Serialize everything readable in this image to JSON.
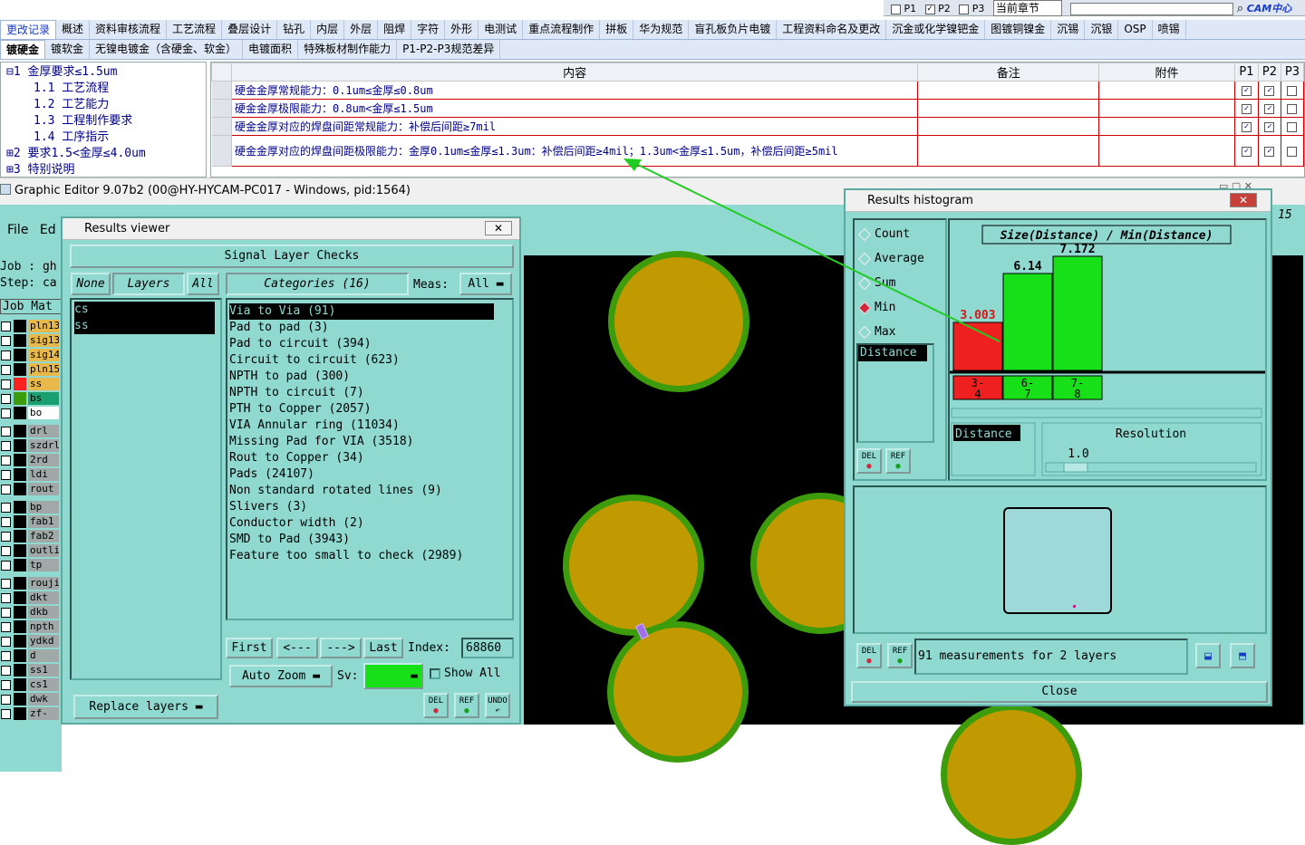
{
  "top_controls": {
    "p1": "P1",
    "p2": "P2",
    "p3": "P3",
    "section_select": "当前章节",
    "logo": "CAM中心"
  },
  "tabs_row1": [
    "更改记录",
    "概述",
    "资料审核流程",
    "工艺流程",
    "叠层设计",
    "钻孔",
    "内层",
    "外层",
    "阻焊",
    "字符",
    "外形",
    "电测试",
    "重点流程制作",
    "拼板",
    "华为规范",
    "盲孔板负片电镀",
    "工程资料命名及更改",
    "沉金或化学镍钯金",
    "图镀铜镍金",
    "沉锡",
    "沉银",
    "OSP",
    "喷锡"
  ],
  "tabs_row2": [
    "镀硬金",
    "镀软金",
    "无镍电镀金（含硬金、软金）",
    "电镀面积",
    "特殊板材制作能力",
    "P1-P2-P3规范差异"
  ],
  "tree": [
    "⊟1 金厚要求≤1.5um",
    "1.1 工艺流程",
    "1.2 工艺能力",
    "1.3 工程制作要求",
    "1.4 工序指示",
    "⊞2 要求1.5<金厚≤4.0um",
    "⊞3 特别说明"
  ],
  "spec_table": {
    "headers": [
      "内容",
      "备注",
      "附件",
      "P1",
      "P2",
      "P3"
    ],
    "rows": [
      {
        "content": "硬金金厚常规能力：0.1um≤金厚≤0.8um",
        "p1": true,
        "p2": true,
        "p3": false
      },
      {
        "content": "硬金金厚极限能力：0.8um<金厚≤1.5um",
        "p1": true,
        "p2": true,
        "p3": false
      },
      {
        "content": "硬金金厚对应的焊盘间距常规能力：补偿后间距≥7mil",
        "p1": true,
        "p2": true,
        "p3": false
      },
      {
        "content": "硬金金厚对应的焊盘间距极限能力：金厚0.1um≤金厚≤1.3um：补偿后间距≥4mil；1.3um<金厚≤1.5um，补偿后间距≥5mil",
        "p1": true,
        "p2": true,
        "p3": false
      }
    ]
  },
  "graphic_editor": {
    "title": "Graphic Editor 9.07b2 (00@HY-HYCAM-PC017 - Windows, pid:1564)",
    "menu": [
      "File",
      "Ed"
    ],
    "job_label": "Job : gh",
    "step_label": "Step: ca",
    "job_matrix": "Job Mat",
    "right_label": "15"
  },
  "layers": [
    {
      "name": "pln13",
      "color": "#e8b84a"
    },
    {
      "name": "sig13",
      "color": "#e8b84a"
    },
    {
      "name": "sig14",
      "color": "#e8b84a"
    },
    {
      "name": "pln15",
      "color": "#e8b84a"
    },
    {
      "name": "ss",
      "color": "#e8b84a",
      "swatch": "#ff2020"
    },
    {
      "name": "bs",
      "color": "#1aa070",
      "swatch": "#3d9c0c"
    },
    {
      "name": "bo",
      "color": "#ffffff"
    },
    {
      "name": "drl",
      "color": "#a0a8a8"
    },
    {
      "name": "szdrl",
      "color": "#a0a8a8"
    },
    {
      "name": "2rd",
      "color": "#a0a8a8"
    },
    {
      "name": "ldi",
      "color": "#a0a8a8"
    },
    {
      "name": "rout",
      "color": "#a0a8a8"
    },
    {
      "name": "bp",
      "color": "#a0a8a8"
    },
    {
      "name": "fab1",
      "color": "#a0a8a8"
    },
    {
      "name": "fab2",
      "color": "#a0a8a8"
    },
    {
      "name": "outli",
      "color": "#a0a8a8"
    },
    {
      "name": "tp",
      "color": "#a0a8a8"
    },
    {
      "name": "rouji",
      "color": "#a0a8a8"
    },
    {
      "name": "dkt",
      "color": "#a0a8a8"
    },
    {
      "name": "dkb",
      "color": "#a0a8a8"
    },
    {
      "name": "npth",
      "color": "#a0a8a8"
    },
    {
      "name": "ydkd",
      "color": "#a0a8a8"
    },
    {
      "name": "d",
      "color": "#a0a8a8"
    },
    {
      "name": "ss1",
      "color": "#a0a8a8"
    },
    {
      "name": "cs1",
      "color": "#a0a8a8"
    },
    {
      "name": "dwk",
      "color": "#a0a8a8"
    },
    {
      "name": "zf-sz",
      "color": "#a0a8a8"
    }
  ],
  "results_viewer": {
    "title": "Results viewer",
    "header": "Signal Layer Checks",
    "none": "None",
    "layers": "Layers",
    "all": "All",
    "categories_label": "Categories (16)",
    "meas_label": "Meas:",
    "meas_value": "All",
    "layer_items": [
      "cs",
      "ss"
    ],
    "categories": [
      "Via to Via (91)",
      "Pad to pad (3)",
      "Pad to circuit (394)",
      "Circuit to circuit (623)",
      "NPTH to pad (300)",
      "NPTH to circuit (7)",
      "PTH to Copper (2057)",
      "VIA Annular ring (11034)",
      "Missing Pad for VIA (3518)",
      "Rout to Copper (34)",
      "Pads (24107)",
      "Non standard rotated lines (9)",
      "Slivers (3)",
      "Conductor width (2)",
      "SMD to Pad (3943)",
      "Feature too small to check (2989)"
    ],
    "first": "First",
    "prev": "<---",
    "next": "--->",
    "last": "Last",
    "index_label": "Index:",
    "index_value": "68860",
    "auto_zoom": "Auto Zoom",
    "sv": "Sv:",
    "show_all": "Show All",
    "replace_layers": "Replace layers",
    "del": "DEL",
    "ref": "REF",
    "undo": "UNDO"
  },
  "histogram": {
    "title": "Results histogram",
    "modes": [
      "Count",
      "Average",
      "Sum",
      "Min",
      "Max"
    ],
    "selected_mode": "Min",
    "chart_title": "Size(Distance) / Min(Distance)",
    "list_item": "Distance",
    "bar_colors": {
      "low": "#ee2020",
      "ok": "#18e018"
    },
    "resolution_label": "Resolution",
    "resolution_value": "1.0",
    "summary": "91 measurements for 2 layers",
    "close": "Close",
    "del": "DEL",
    "ref": "REF"
  },
  "chart_data": {
    "type": "bar",
    "title": "Size(Distance) / Min(Distance)",
    "categories": [
      "3-4",
      "6-7",
      "7-8"
    ],
    "values": [
      3.003,
      6.14,
      7.172
    ],
    "colors": [
      "#ee2020",
      "#18e018",
      "#18e018"
    ],
    "ylim": [
      0,
      8
    ]
  }
}
